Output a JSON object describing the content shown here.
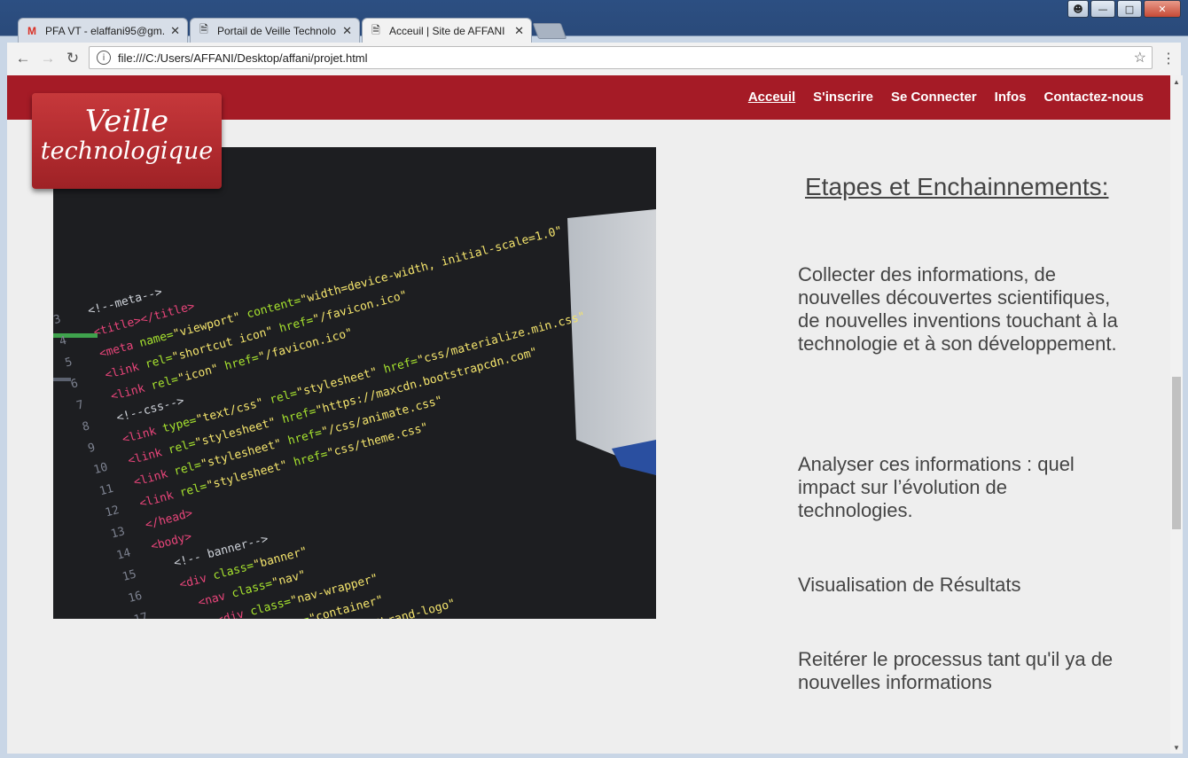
{
  "browser": {
    "tabs": [
      {
        "label": "PFA VT - elaffani95@gm...",
        "icon": "gmail-icon"
      },
      {
        "label": "Portail de Veille Technolo...",
        "icon": "page-icon"
      },
      {
        "label": "Acceuil | Site de AFFANI",
        "icon": "page-icon"
      }
    ],
    "url": "file:///C:/Users/AFFANI/Desktop/affani/projet.html"
  },
  "site": {
    "logo": {
      "line1": "Veille",
      "line2": "technologique"
    },
    "nav": [
      "Acceuil",
      "S'inscrire",
      "Se Connecter",
      "Infos",
      "Contactez-nous"
    ],
    "heading": "Etapes et Enchainnements:",
    "steps": [
      "Collecter des informations, de nouvelles découvertes scientifiques, de nouvelles inventions touchant à la technologie et à son développement.",
      "Analyser ces informations : quel impact sur l’évolution de technologies.",
      "Visualisation de Résultats",
      "Reitérer le processus tant qu'il ya de nouvelles informations"
    ]
  },
  "colors": {
    "header": "#a51b26",
    "text": "#444444",
    "background": "#eeeeee"
  }
}
